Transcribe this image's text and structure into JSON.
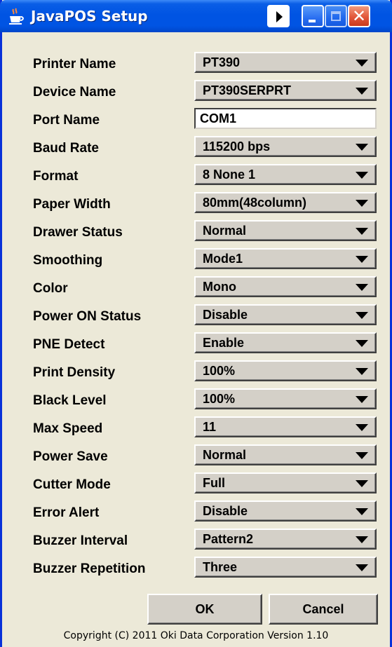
{
  "window": {
    "title": "JavaPOS Setup",
    "icons": {
      "app": "java-cup-icon",
      "menu": "menu-arrow-icon",
      "minimize": "minimize-icon",
      "maximize": "maximize-icon",
      "close": "close-icon"
    }
  },
  "fields": [
    {
      "label": "Printer Name",
      "value": "PT390",
      "type": "select"
    },
    {
      "label": "Device Name",
      "value": "PT390SERPRT",
      "type": "select"
    },
    {
      "label": "Port Name",
      "value": "COM1",
      "type": "text"
    },
    {
      "label": "Baud Rate",
      "value": "115200 bps",
      "type": "select"
    },
    {
      "label": "Format",
      "value": "8 None 1",
      "type": "select"
    },
    {
      "label": "Paper Width",
      "value": "80mm(48column)",
      "type": "select"
    },
    {
      "label": "Drawer Status",
      "value": "Normal",
      "type": "select"
    },
    {
      "label": "Smoothing",
      "value": "Mode1",
      "type": "select"
    },
    {
      "label": "Color",
      "value": "Mono",
      "type": "select"
    },
    {
      "label": "Power ON Status",
      "value": "Disable",
      "type": "select"
    },
    {
      "label": "PNE Detect",
      "value": "Enable",
      "type": "select"
    },
    {
      "label": "Print Density",
      "value": "100%",
      "type": "select"
    },
    {
      "label": "Black Level",
      "value": "100%",
      "type": "select"
    },
    {
      "label": "Max Speed",
      "value": "11",
      "type": "select"
    },
    {
      "label": "Power Save",
      "value": "Normal",
      "type": "select"
    },
    {
      "label": "Cutter Mode",
      "value": "Full",
      "type": "select"
    },
    {
      "label": "Error Alert",
      "value": "Disable",
      "type": "select"
    },
    {
      "label": "Buzzer Interval",
      "value": "Pattern2",
      "type": "select"
    },
    {
      "label": "Buzzer Repetition",
      "value": "Three",
      "type": "select"
    }
  ],
  "buttons": {
    "ok": "OK",
    "cancel": "Cancel"
  },
  "footer": {
    "copyright": "Copyright (C) 2011 Oki Data Corporation Version 1.10"
  },
  "colors": {
    "titlebar": "#0054e3",
    "window_bg": "#ece9d8",
    "control_bg": "#d4d0c8",
    "close": "#e2573a"
  }
}
